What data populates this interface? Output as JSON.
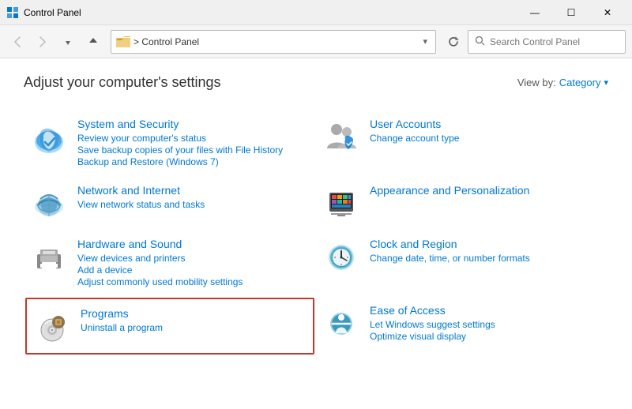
{
  "titlebar": {
    "icon": "⊞",
    "title": "Control Panel",
    "minimize": "—",
    "maximize": "☐",
    "close": "✕"
  },
  "toolbar": {
    "back_title": "Back",
    "forward_title": "Forward",
    "up_title": "Up",
    "address_icon": "folder",
    "address_path": "> Control Panel",
    "chevron": "▾",
    "refresh_title": "Refresh",
    "search_placeholder": "Search Control Panel"
  },
  "main": {
    "heading": "Adjust your computer's settings",
    "view_by_label": "View by:",
    "view_by_value": "Category",
    "items": [
      {
        "id": "system-security",
        "title": "System and Security",
        "links": [
          "Review your computer's status",
          "Save backup copies of your files with File History",
          "Backup and Restore (Windows 7)"
        ],
        "highlighted": false
      },
      {
        "id": "user-accounts",
        "title": "User Accounts",
        "links": [
          "Change account type"
        ],
        "highlighted": false
      },
      {
        "id": "network-internet",
        "title": "Network and Internet",
        "links": [
          "View network status and tasks"
        ],
        "highlighted": false
      },
      {
        "id": "appearance-personalization",
        "title": "Appearance and Personalization",
        "links": [],
        "highlighted": false
      },
      {
        "id": "hardware-sound",
        "title": "Hardware and Sound",
        "links": [
          "View devices and printers",
          "Add a device",
          "Adjust commonly used mobility settings"
        ],
        "highlighted": false
      },
      {
        "id": "clock-region",
        "title": "Clock and Region",
        "links": [
          "Change date, time, or number formats"
        ],
        "highlighted": false
      },
      {
        "id": "programs",
        "title": "Programs",
        "links": [
          "Uninstall a program"
        ],
        "highlighted": true
      },
      {
        "id": "ease-of-access",
        "title": "Ease of Access",
        "links": [
          "Let Windows suggest settings",
          "Optimize visual display"
        ],
        "highlighted": false
      }
    ]
  }
}
